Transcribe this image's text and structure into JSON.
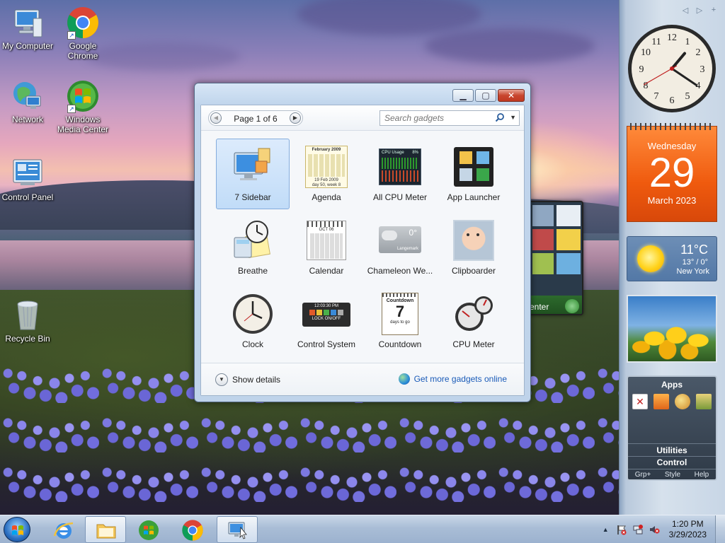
{
  "desktop": {
    "icons": [
      {
        "label": "My Computer"
      },
      {
        "label": "Google Chrome"
      },
      {
        "label": "Network"
      },
      {
        "label": "Windows Media Center"
      },
      {
        "label": "Control Panel"
      },
      {
        "label": "Recycle Bin"
      }
    ]
  },
  "gallery": {
    "pager_text": "Page 1 of 6",
    "search_placeholder": "Search gadgets",
    "gadgets": [
      {
        "label": "7 Sidebar",
        "selected": true
      },
      {
        "label": "Agenda"
      },
      {
        "label": "All CPU Meter"
      },
      {
        "label": "App Launcher"
      },
      {
        "label": "Breathe"
      },
      {
        "label": "Calendar"
      },
      {
        "label": "Chameleon We..."
      },
      {
        "label": "Clipboarder"
      },
      {
        "label": "Clock"
      },
      {
        "label": "Control System"
      },
      {
        "label": "Countdown"
      },
      {
        "label": "CPU Meter"
      }
    ],
    "show_details": "Show details",
    "get_more": "Get more gadgets online",
    "art_text": {
      "agenda_month": "February 2009",
      "agenda_date": "19 Feb 2009",
      "agenda_sub": "day 50, week 8",
      "cpu_title": "CPU Usage",
      "cpu_pct": "8%",
      "cal_month": "OCT 06",
      "chameleon_temp": "0°",
      "chameleon_city": "Langemark",
      "ctrl_time": "12:03:30 PM",
      "ctrl_lock": "LOCK ON/OFF",
      "countdown_head": "Countdown",
      "countdown_num": "7",
      "countdown_sub": "days to go"
    }
  },
  "behind_gadget": {
    "label": "enter"
  },
  "sidebar": {
    "nav": [
      "◁",
      "▷",
      "+"
    ],
    "calendar": {
      "weekday": "Wednesday",
      "day": "29",
      "month_year": "March 2023"
    },
    "weather": {
      "temp": "11°C",
      "hilo": "13° / 0°",
      "city": "New York"
    },
    "apps": {
      "title": "Apps",
      "utilities": "Utilities",
      "control": "Control",
      "bottom": [
        "Grp+",
        "Style",
        "Help"
      ]
    },
    "clock": {
      "hour": 1,
      "minute": 20,
      "second": 40
    }
  },
  "taskbar": {
    "time": "1:20 PM",
    "date": "3/29/2023",
    "tray_arrow": "▲"
  },
  "colors": {
    "accent": "#2b6fc2",
    "calendar_orange": "#ef5a0e",
    "link_blue": "#1a5bb8"
  }
}
